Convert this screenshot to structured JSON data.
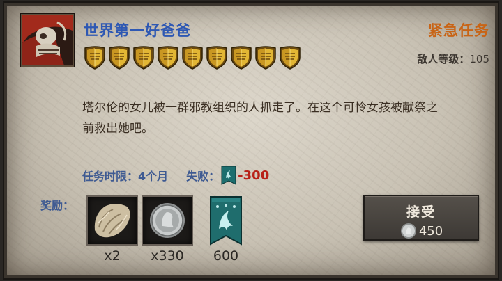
{
  "quest": {
    "title": "世界第一好爸爸",
    "urgency": "紧急任务",
    "enemy_level_label": "敌人等级：",
    "enemy_level": "105",
    "difficulty_shields": 9,
    "description": "塔尔伦的女儿被一群邪教组织的人抓走了。在这个可怜女孩被献祭之前救出她吧。",
    "time_limit_label": "任务时限：",
    "time_limit": "4个月",
    "fail_label": "失败：",
    "fail_value": "-300"
  },
  "rewards": {
    "label": "奖励：",
    "items": [
      {
        "icon": "fur-pelt-icon",
        "count": "x2"
      },
      {
        "icon": "silver-coin-icon",
        "count": "x330"
      },
      {
        "icon": "banner-icon",
        "count": "600"
      }
    ]
  },
  "accept_button": {
    "label": "接受",
    "cost": "450",
    "cost_icon": "silver-coin-icon"
  },
  "colors": {
    "title": "#2e58b3",
    "urgent": "#c86416",
    "fail": "#b82218",
    "label_blue": "#3e5a92"
  }
}
